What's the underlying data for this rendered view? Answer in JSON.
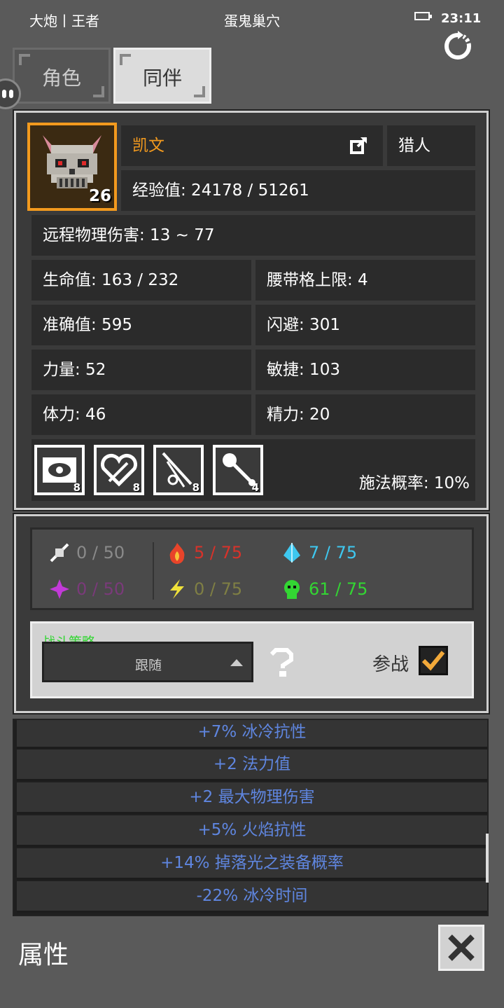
{
  "status_bar": {
    "left_text": "大炮丨王者",
    "center_text": "蛋鬼巢穴",
    "time": "23:11"
  },
  "tabs": [
    {
      "label": "角色",
      "active": false
    },
    {
      "label": "同伴",
      "active": true
    }
  ],
  "companion": {
    "name": "凯文",
    "class": "猎人",
    "level": "26",
    "experience": "经验值: 24178 / 51261",
    "ranged_damage": "远程物理伤害: 13 ~ 77",
    "hp": "生命值: 163 / 232",
    "belt_limit": "腰带格上限: 4",
    "accuracy": "准确值: 595",
    "dodge": "闪避: 301",
    "strength": "力量: 52",
    "agility": "敏捷: 103",
    "vitality": "体力: 46",
    "energy": "精力: 20",
    "cast_chance": "施法概率: 10%",
    "skills": [
      {
        "icon": "eye-skill-icon",
        "count": "8"
      },
      {
        "icon": "heart-skill-icon",
        "count": "8"
      },
      {
        "icon": "arrow-rain-skill-icon",
        "count": "8"
      },
      {
        "icon": "mace-skill-icon",
        "count": "4"
      }
    ]
  },
  "resistances": {
    "physical": {
      "value": "0 / 50",
      "color": "#8a8a8a"
    },
    "fire": {
      "value": "5 / 75",
      "color": "#d8322a"
    },
    "cold": {
      "value": "7 / 75",
      "color": "#3ec8f0"
    },
    "magic": {
      "value": "0 / 50",
      "color": "#7a3a7a"
    },
    "lightning": {
      "value": "0 / 75",
      "color": "#7f7f44"
    },
    "poison": {
      "value": "61 / 75",
      "color": "#33d633"
    }
  },
  "strategy": {
    "label": "战斗策略",
    "selected": "跟随",
    "join_label": "参战",
    "join_checked": true
  },
  "affixes": [
    "+7% 冰冷抗性",
    "+2 法力值",
    "+2 最大物理伤害",
    "+5% 火焰抗性",
    "+14% 掉落光之装备概率",
    "-22% 冰冷时间"
  ],
  "footer": {
    "title": "属性"
  }
}
